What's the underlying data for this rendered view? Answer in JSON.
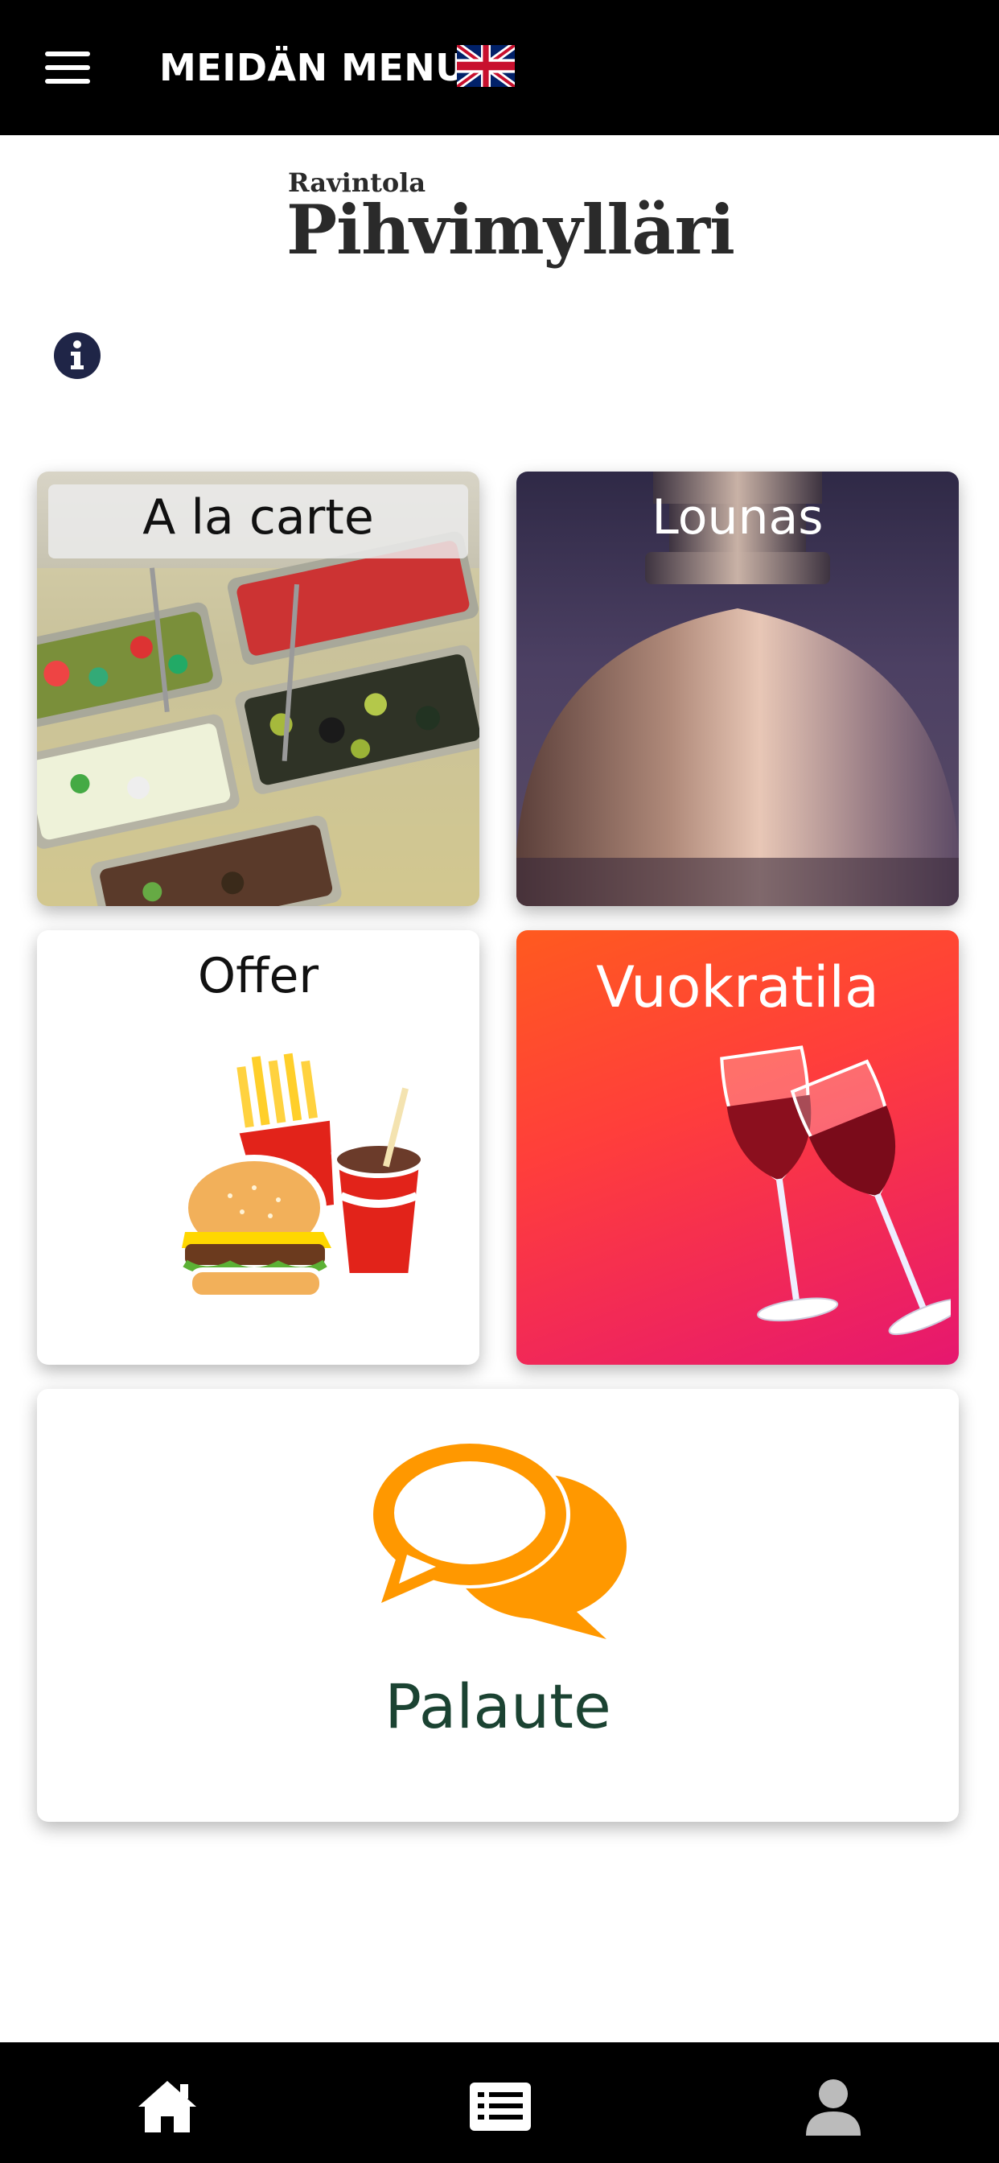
{
  "header": {
    "title": "MEIDÄN MENU",
    "menu_icon": "hamburger-icon",
    "language_flag": "uk-flag-icon"
  },
  "logo": {
    "small": "Ravintola",
    "big": "Pihvimylläri"
  },
  "info_icon": "info-icon",
  "tiles": {
    "alacarte": {
      "label": "A la carte"
    },
    "lounas": {
      "label": "Lounas"
    },
    "offer": {
      "label": "Offer"
    },
    "vuokratila": {
      "label": "Vuokratila"
    },
    "palaute": {
      "label": "Palaute"
    }
  },
  "bottom_nav": [
    {
      "icon": "home-icon"
    },
    {
      "icon": "list-icon"
    },
    {
      "icon": "user-icon"
    }
  ],
  "colors": {
    "header_bg": "#000000",
    "palaute_icon": "#ff9800",
    "palaute_text": "#1b4332",
    "vuokratila_gradient_start": "#ff5a1f",
    "vuokratila_gradient_end": "#e6176f"
  }
}
